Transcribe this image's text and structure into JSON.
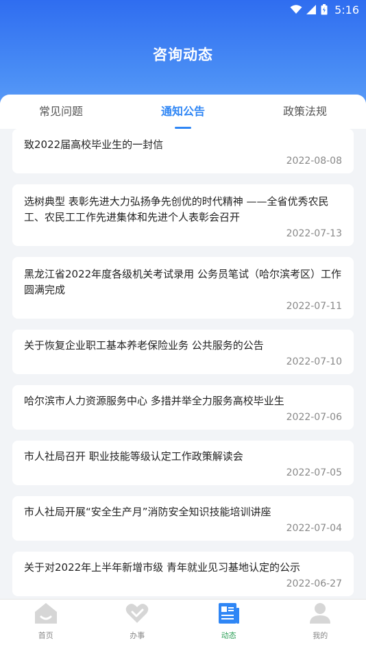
{
  "status_bar": {
    "time": "5:16"
  },
  "header": {
    "title": "咨询动态"
  },
  "tabs": [
    {
      "label": "常见问题",
      "active": false
    },
    {
      "label": "通知公告",
      "active": true
    },
    {
      "label": "政策法规",
      "active": false
    }
  ],
  "notices": [
    {
      "title": "致2022届高校毕业生的一封信",
      "date": "2022-08-08"
    },
    {
      "title": "选树典型 表彰先进大力弘扬争先创优的时代精神 ——全省优秀农民工、农民工工作先进集体和先进个人表彰会召开",
      "date": "2022-07-13"
    },
    {
      "title": "黑龙江省2022年度各级机关考试录用 公务员笔试（哈尔滨考区）工作圆满完成",
      "date": "2022-07-11"
    },
    {
      "title": "关于恢复企业职工基本养老保险业务 公共服务的公告",
      "date": "2022-07-10"
    },
    {
      "title": "哈尔滨市人力资源服务中心 多措并举全力服务高校毕业生",
      "date": "2022-07-06"
    },
    {
      "title": "市人社局召开 职业技能等级认定工作政策解读会",
      "date": "2022-07-05"
    },
    {
      "title": "市人社局开展“安全生产月”消防安全知识技能培训讲座",
      "date": "2022-07-04"
    },
    {
      "title": "关于对2022年上半年新增市级 青年就业见习基地认定的公示",
      "date": "2022-06-27"
    }
  ],
  "bottom_nav": [
    {
      "label": "首页",
      "icon": "home-icon",
      "active": false
    },
    {
      "label": "办事",
      "icon": "heart-icon",
      "active": false
    },
    {
      "label": "动态",
      "icon": "news-icon",
      "active": true
    },
    {
      "label": "我的",
      "icon": "user-icon",
      "active": false
    }
  ],
  "colors": {
    "accent": "#2f86f5",
    "nav_active": "#2a9e55",
    "header": "#3a7ff2"
  }
}
